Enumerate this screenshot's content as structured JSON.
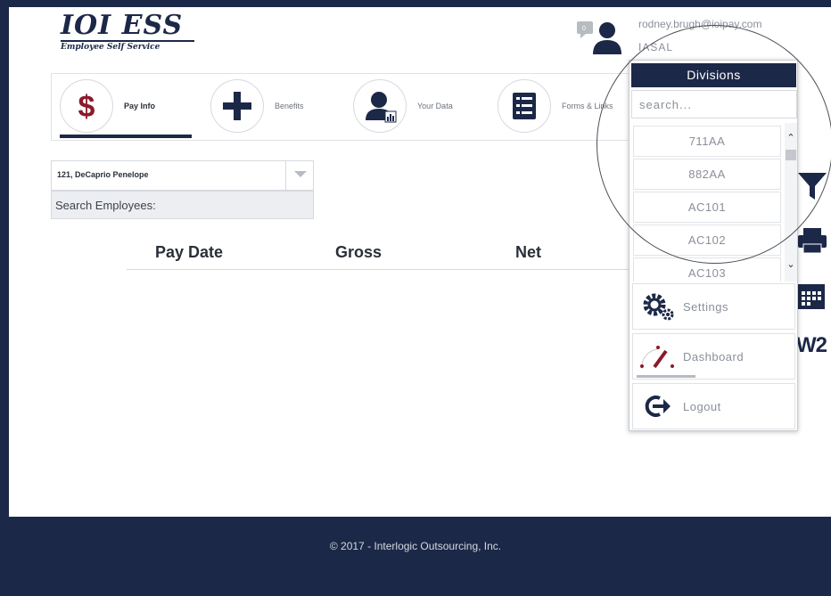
{
  "app": {
    "brand": "IOI ESS",
    "tagline": "Employee Self Service"
  },
  "user": {
    "email": "rodney.brugh@ioipay.com",
    "org": "IASAL",
    "chat_badge": "0"
  },
  "nav": {
    "items": [
      {
        "label": "Pay Info",
        "icon": "dollar-icon",
        "active": true
      },
      {
        "label": "Benefits",
        "icon": "plus-icon",
        "active": false
      },
      {
        "label": "Your Data",
        "icon": "person-chart-icon",
        "active": false
      },
      {
        "label": "Forms & Links",
        "icon": "list-icon",
        "active": false
      }
    ]
  },
  "employee_select": {
    "value": "121, DeCaprio Penelope",
    "search_label": "Search Employees:"
  },
  "pay_table": {
    "columns": [
      "Pay Date",
      "Gross",
      "Net"
    ]
  },
  "tools": [
    "filter-icon",
    "print-icon",
    "calendar-icon",
    "w2-icon"
  ],
  "w2_label": "W2",
  "divisions": {
    "title": "Divisions",
    "search_placeholder": "search...",
    "items": [
      "711AA",
      "882AA",
      "AC101",
      "AC102",
      "AC103"
    ]
  },
  "menu": {
    "settings": "Settings",
    "dashboard": "Dashboard",
    "logout": "Logout"
  },
  "footer": {
    "text": "© 2017 - Interlogic Outsourcing, Inc."
  },
  "colors": {
    "navy": "#1c2847",
    "accent_red": "#8b1a2b"
  }
}
